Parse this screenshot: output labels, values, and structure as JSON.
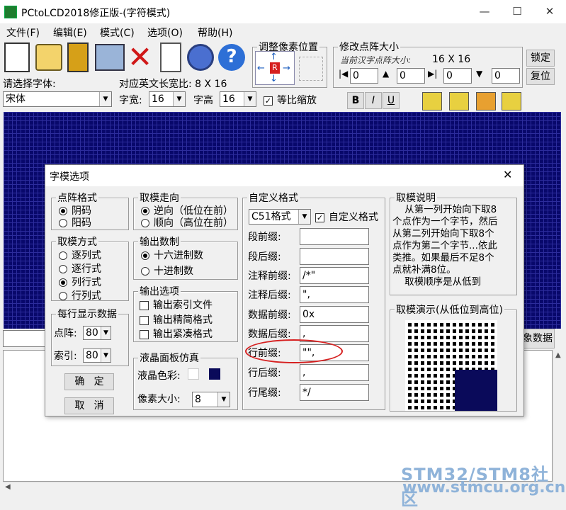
{
  "window": {
    "title": "PCtoLCD2018修正版-(字符模式)",
    "minimize": "—",
    "maximize": "☐",
    "close": "✕"
  },
  "menu": [
    "文件(F)",
    "编辑(E)",
    "模式(C)",
    "选项(O)",
    "帮助(H)"
  ],
  "toolbar": {
    "adjust_group_title": "调整像素位置",
    "dotmatrix_group_title": "修改点阵大小",
    "current_size_label": "当前汉字点阵大小:",
    "current_size_value": "16 X 16",
    "lock_button": "锁定",
    "reset_button": "复位",
    "dot_values": [
      "0",
      "0",
      "0",
      "0"
    ]
  },
  "font_row": {
    "select_font_label": "请选择字体:",
    "font_value": "宋体",
    "ratio_label": "对应英文长宽比: 8 X 16",
    "width_label": "字宽:",
    "width_value": "16",
    "height_label": "字高",
    "height_value": "16",
    "proportional_label": "等比缩放",
    "bold": "B",
    "italic": "I",
    "underline": "U"
  },
  "bottom": {
    "gen_data_button": "象数据"
  },
  "watermark": {
    "line1": "STM32/STM8社区",
    "line2": "www.stmcu.org.cn"
  },
  "dialog": {
    "title": "字模选项",
    "close": "✕",
    "dot_format": {
      "title": "点阵格式",
      "options": [
        "阴码",
        "阳码"
      ],
      "selected": 0
    },
    "scan_mode": {
      "title": "取模方式",
      "options": [
        "逐列式",
        "逐行式",
        "列行式",
        "行列式"
      ],
      "selected": 2
    },
    "per_line": {
      "title": "每行显示数据",
      "dot_label": "点阵:",
      "dot_value": "80",
      "index_label": "索引:",
      "index_value": "80"
    },
    "ok_button": "确   定",
    "cancel_button": "取   消",
    "direction": {
      "title": "取模走向",
      "options": [
        "逆向（低位在前）",
        "顺向（高位在前）"
      ],
      "selected": 0
    },
    "output_base": {
      "title": "输出数制",
      "options": [
        "十六进制数",
        "十进制数"
      ],
      "selected": 0
    },
    "output_options": {
      "title": "输出选项",
      "options": [
        "输出索引文件",
        "输出精简格式",
        "输出紧凑格式"
      ]
    },
    "lcd_sim": {
      "title": "液晶面板仿真",
      "color_label": "液晶色彩:",
      "pixel_size_label": "像素大小:",
      "pixel_size_value": "8"
    },
    "custom_format": {
      "title": "自定义格式",
      "format_value": "C51格式",
      "custom_check_label": "自定义格式",
      "fields": [
        {
          "label": "段前缀:",
          "value": ""
        },
        {
          "label": "段后缀:",
          "value": ""
        },
        {
          "label": "注释前缀:",
          "value": "/*\""
        },
        {
          "label": "注释后缀:",
          "value": "\","
        },
        {
          "label": "数据前缀:",
          "value": "0x"
        },
        {
          "label": "数据后缀:",
          "value": ","
        },
        {
          "label": "行前缀:",
          "value": "\"\","
        },
        {
          "label": "行后缀:",
          "value": ","
        },
        {
          "label": "行尾缀:",
          "value": "*/"
        }
      ]
    },
    "explain": {
      "title": "取模说明",
      "text": "    从第一列开始向下取8个点作为一个字节，然后从第二列开始向下取8个点作为第二个字节...依此类推。如果最后不足8个点就补满8位。\n    取模顺序是从低到"
    },
    "demo": {
      "title": "取模演示(从低位到高位)"
    }
  },
  "colors": {
    "grid_bg": "#08086b",
    "highlight_circle": "#d62020",
    "watermark": "#8fb3d9",
    "lcd_dark": "#0a0a5a"
  }
}
